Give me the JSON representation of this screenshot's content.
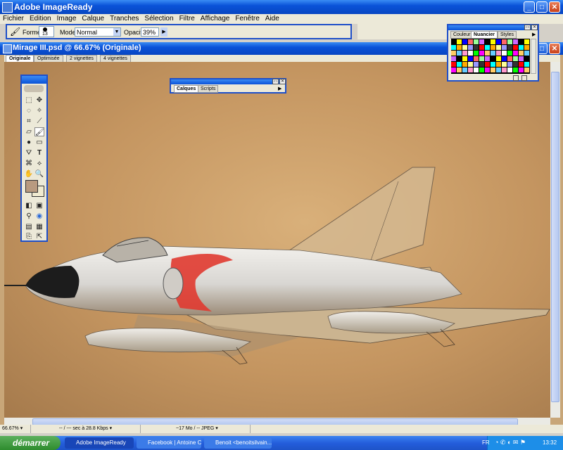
{
  "app": {
    "title": "Adobe ImageReady"
  },
  "menu": [
    "Fichier",
    "Edition",
    "Image",
    "Calque",
    "Tranches",
    "Sélection",
    "Filtre",
    "Affichage",
    "Fenêtre",
    "Aide"
  ],
  "options": {
    "forme_label": "Forme:",
    "brush_size": "13",
    "mode_label": "Mode:",
    "mode_value": "Normal",
    "opacity_label": "Opacité:",
    "opacity_value": "39%"
  },
  "document": {
    "title": "Mirage III.psd @ 66.67% (Originale)",
    "tabs": [
      "Originale",
      "Optimisée",
      "2 vignettes",
      "4 vignettes"
    ]
  },
  "palettes": {
    "color": {
      "tabs": [
        "Couleur",
        "Nuancier",
        "Styles"
      ]
    },
    "layers": {
      "tabs": [
        "Calques",
        "Scripts"
      ]
    }
  },
  "status": {
    "zoom": "66.67%",
    "time": "-- / --- sec à 28.8 Kbps",
    "size": "~17 Mo / -- JPEG"
  },
  "taskbar": {
    "start_label": "démarrer",
    "tasks": [
      "Adobe ImageReady",
      "Facebook | Antoine C...",
      "Benoit <benoitsilvain..."
    ],
    "lang": "FR",
    "clock": "13:32"
  },
  "colors": {
    "titlebar": "#0a52d8",
    "accent": "#1e4fc9",
    "canvas": "#c49560",
    "taskbar": "#245edc",
    "start": "#2e8c2e"
  }
}
